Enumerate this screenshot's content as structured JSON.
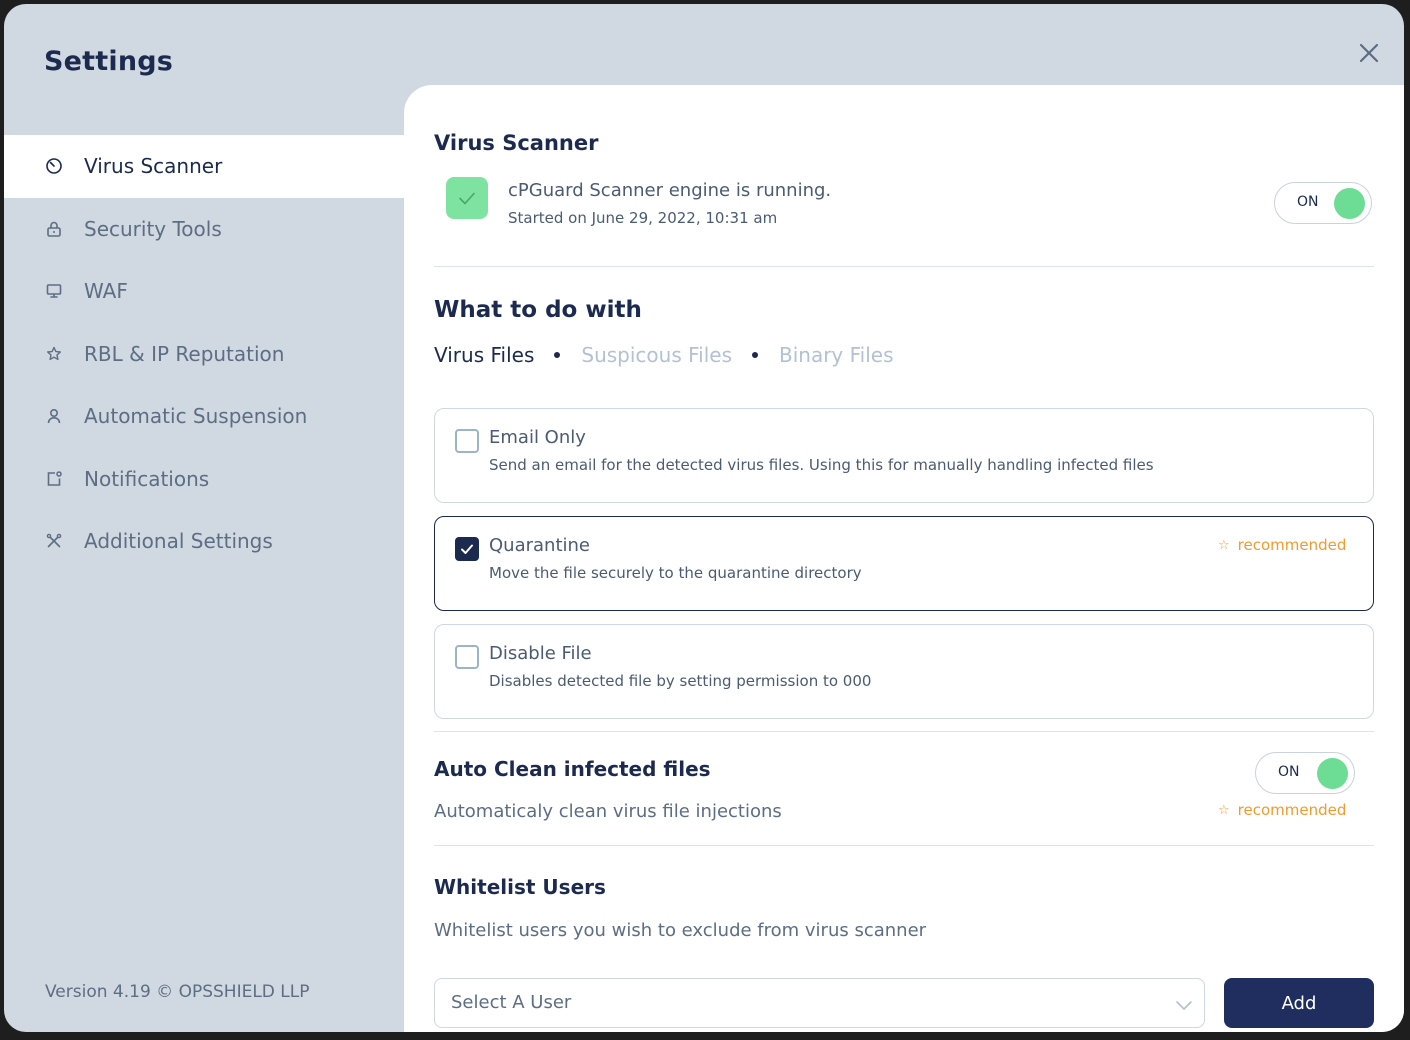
{
  "modal": {
    "title": "Settings"
  },
  "sidebar": {
    "items": [
      {
        "label": "Virus Scanner",
        "icon": "timer-icon",
        "active": true
      },
      {
        "label": "Security Tools",
        "icon": "lock-icon"
      },
      {
        "label": "WAF",
        "icon": "monitor-icon"
      },
      {
        "label": "RBL & IP Reputation",
        "icon": "star-icon"
      },
      {
        "label": "Automatic Suspension",
        "icon": "user-icon"
      },
      {
        "label": "Notifications",
        "icon": "notification-icon"
      },
      {
        "label": "Additional Settings",
        "icon": "tools-icon"
      }
    ],
    "version": "Version 4.19 © OPSSHIELD LLP"
  },
  "virus_scanner": {
    "heading": "Virus Scanner",
    "engine_status": "cPGuard Scanner engine is running.",
    "started": "Started on June 29, 2022, 10:31 am",
    "toggle_label": "ON"
  },
  "what_to_do": {
    "heading": "What to do with",
    "tabs": [
      {
        "label": "Virus Files",
        "active": true
      },
      {
        "label": "Suspicous Files"
      },
      {
        "label": "Binary Files"
      }
    ],
    "options": [
      {
        "title": "Email Only",
        "desc": "Send an email for the detected virus files. Using this for manually handling infected files",
        "checked": false
      },
      {
        "title": "Quarantine",
        "desc": "Move the file securely to the quarantine directory",
        "checked": true,
        "badge": "recommended"
      },
      {
        "title": "Disable File",
        "desc": "Disables detected file by setting permission to 000",
        "checked": false
      }
    ]
  },
  "auto_clean": {
    "heading": "Auto Clean infected files",
    "desc": "Automaticaly clean virus file injections",
    "toggle_label": "ON",
    "badge": "recommended"
  },
  "whitelist": {
    "heading": "Whitelist Users",
    "desc": "Whitelist users you wish to exclude from virus scanner",
    "select_placeholder": "Select A User",
    "add_label": "Add"
  },
  "colors": {
    "navy": "#1b2a4e",
    "toggle_green": "#6ddc94",
    "recommended_orange": "#f29a2e",
    "sidebar_bg": "#d0d9e1"
  }
}
